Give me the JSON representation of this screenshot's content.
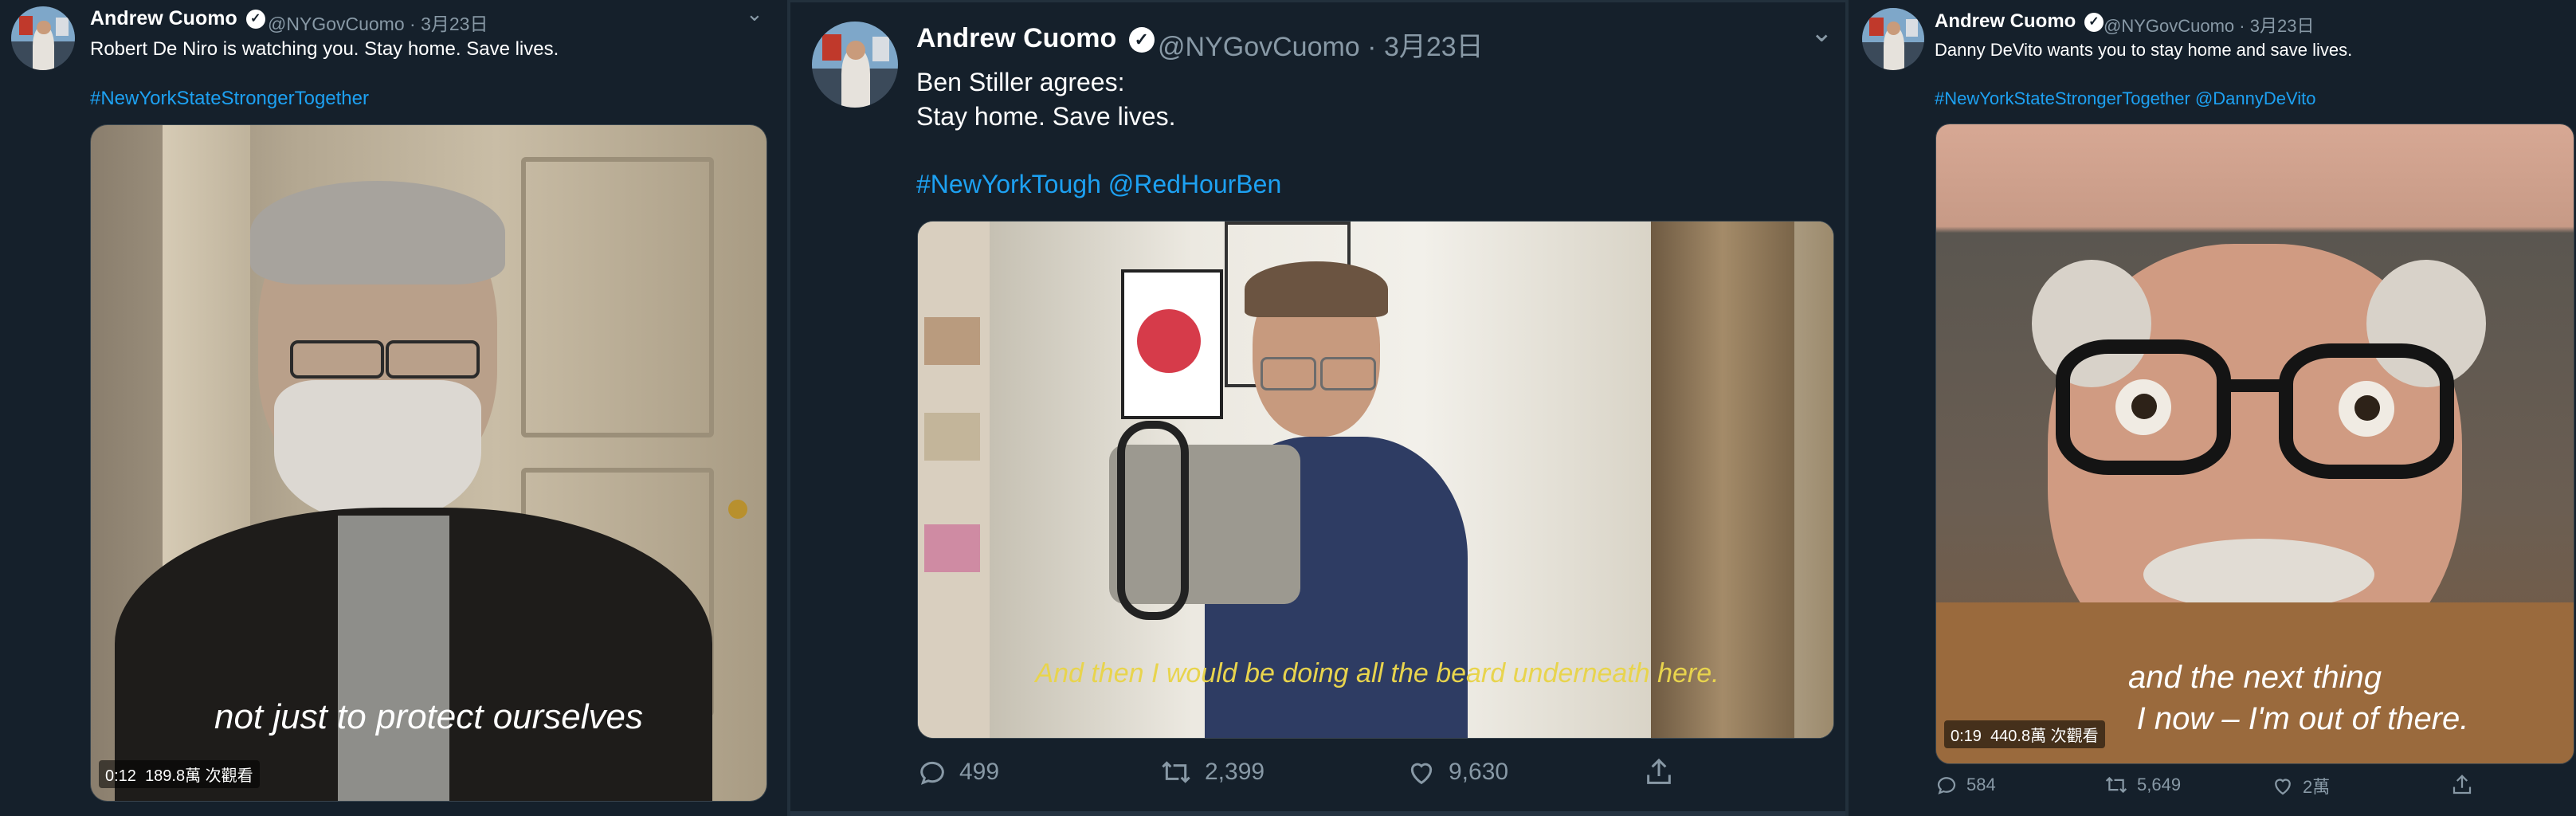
{
  "tweets": [
    {
      "author": {
        "name": "Andrew Cuomo",
        "handle": "@NYGovCuomo",
        "date": "· 3月23日"
      },
      "text_line1": "Robert De Niro is watching you. Stay home. Save lives.",
      "hashtags": "#NewYorkStateStrongerTogether",
      "video": {
        "caption": "not just to protect ourselves",
        "time": "0:12",
        "views": "189.8萬 次觀看"
      }
    },
    {
      "author": {
        "name": "Andrew Cuomo",
        "handle": "@NYGovCuomo",
        "date": "· 3月23日"
      },
      "text_line1": "Ben Stiller agrees:",
      "text_line2": "Stay home. Save lives.",
      "hashtags": "#NewYorkTough @RedHourBen",
      "video": {
        "caption": "And then I would be doing all the beard underneath here."
      },
      "actions": {
        "replies": "499",
        "retweets": "2,399",
        "likes": "9,630"
      }
    },
    {
      "author": {
        "name": "Andrew Cuomo",
        "handle": "@NYGovCuomo",
        "date": "· 3月23日"
      },
      "text_line1": "Danny DeVito wants you to stay home and save lives.",
      "hashtags": "#NewYorkStateStrongerTogether @DannyDeVito",
      "video": {
        "caption_line1": "and the next thing",
        "caption_line2": "I now – I'm out of there.",
        "time": "0:19",
        "views": "440.8萬 次觀看"
      },
      "actions": {
        "replies": "584",
        "retweets": "5,649",
        "likes": "2萬"
      }
    }
  ],
  "colors": {
    "background": "#15202b",
    "link": "#1da1f2",
    "muted": "#8899a6",
    "caption_yellow": "#e8d44d"
  },
  "icons": [
    "verified-badge-icon",
    "chevron-down-icon",
    "reply-icon",
    "retweet-icon",
    "like-icon",
    "share-icon"
  ]
}
